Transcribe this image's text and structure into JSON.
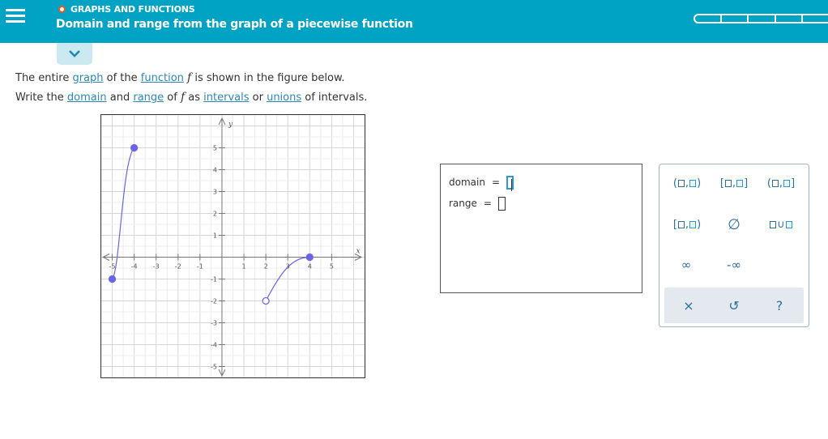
{
  "header": {
    "topic": "GRAPHS AND FUNCTIONS",
    "title": "Domain and range from the graph of a piecewise function",
    "progress_segments": 5
  },
  "question": {
    "line1": {
      "p1": "The entire ",
      "link1": "graph",
      "p2": " of the ",
      "link2": "function",
      "p3": " ",
      "f": "f",
      "p4": " is shown in the figure below."
    },
    "line2": {
      "p1": "Write the ",
      "link1": "domain",
      "p2": " and ",
      "link2": "range",
      "p3": " of ",
      "f": "f",
      "p4": " as ",
      "link3": "intervals",
      "p5": " or ",
      "link4": "unions",
      "p6": " of intervals."
    }
  },
  "graph": {
    "x_axis_label": "x",
    "y_axis_label": "y",
    "x_ticks": [
      "-5",
      "-4",
      "-3",
      "-2",
      "-1",
      "1",
      "2",
      "3",
      "4",
      "5"
    ],
    "y_ticks": [
      "5",
      "4",
      "3",
      "2",
      "1",
      "-1",
      "-2",
      "-3",
      "-4",
      "-5"
    ],
    "xlim": [
      -5.5,
      6.5
    ],
    "ylim": [
      -5.5,
      6.5
    ],
    "curve_color": "#6a64e8",
    "pieces": [
      {
        "start": {
          "x": -5,
          "y": -1,
          "closed": true
        },
        "end": {
          "x": -4,
          "y": 5,
          "closed": true
        }
      },
      {
        "start": {
          "x": 2,
          "y": -2,
          "closed": false
        },
        "end": {
          "x": 4,
          "y": 0,
          "closed": true
        }
      }
    ]
  },
  "answer": {
    "domain_label": "domain",
    "range_label": "range",
    "equals": "="
  },
  "palette": {
    "open_interval": [
      "(",
      ",",
      ")"
    ],
    "closed_interval": [
      "[",
      ",",
      "]"
    ],
    "left_open_interval": [
      "(",
      ",",
      "]"
    ],
    "right_open_interval": [
      "[",
      ",",
      ")"
    ],
    "empty_set": "∅",
    "union": "∪",
    "infinity": "∞",
    "neg_infinity": "-∞",
    "clear": "×",
    "undo": "↺",
    "help": "?"
  },
  "colors": {
    "header_bg": "#00a3c4",
    "link": "#2d87b8",
    "topic_dot": "#e85a25",
    "palette_blue": "#2d6fa0"
  }
}
